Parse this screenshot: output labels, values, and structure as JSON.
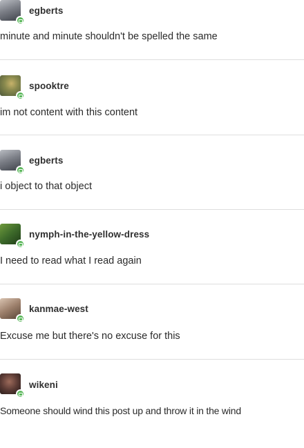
{
  "posts": [
    {
      "username": "egberts",
      "avatar_icon": "user-avatar-icon",
      "text": "minute and minute shouldn't be spelled the same"
    },
    {
      "username": "spooktre",
      "avatar_icon": "user-avatar-icon",
      "text": "im not content with this content"
    },
    {
      "username": "egberts",
      "avatar_icon": "user-avatar-icon",
      "text": "i object to that object"
    },
    {
      "username": "nymph-in-the-yellow-dress",
      "avatar_icon": "user-avatar-icon",
      "text": "I need to read what I read again"
    },
    {
      "username": "kanmae-west",
      "avatar_icon": "user-avatar-icon",
      "text": "Excuse me but there's no excuse for this"
    },
    {
      "username": "wikeni",
      "avatar_icon": "user-avatar-icon",
      "text": "Someone should wind this post up and throw it in the wind"
    }
  ],
  "colors": {
    "badge": "#5cb85c",
    "divider": "#dedede",
    "text": "#2a2a2a"
  }
}
